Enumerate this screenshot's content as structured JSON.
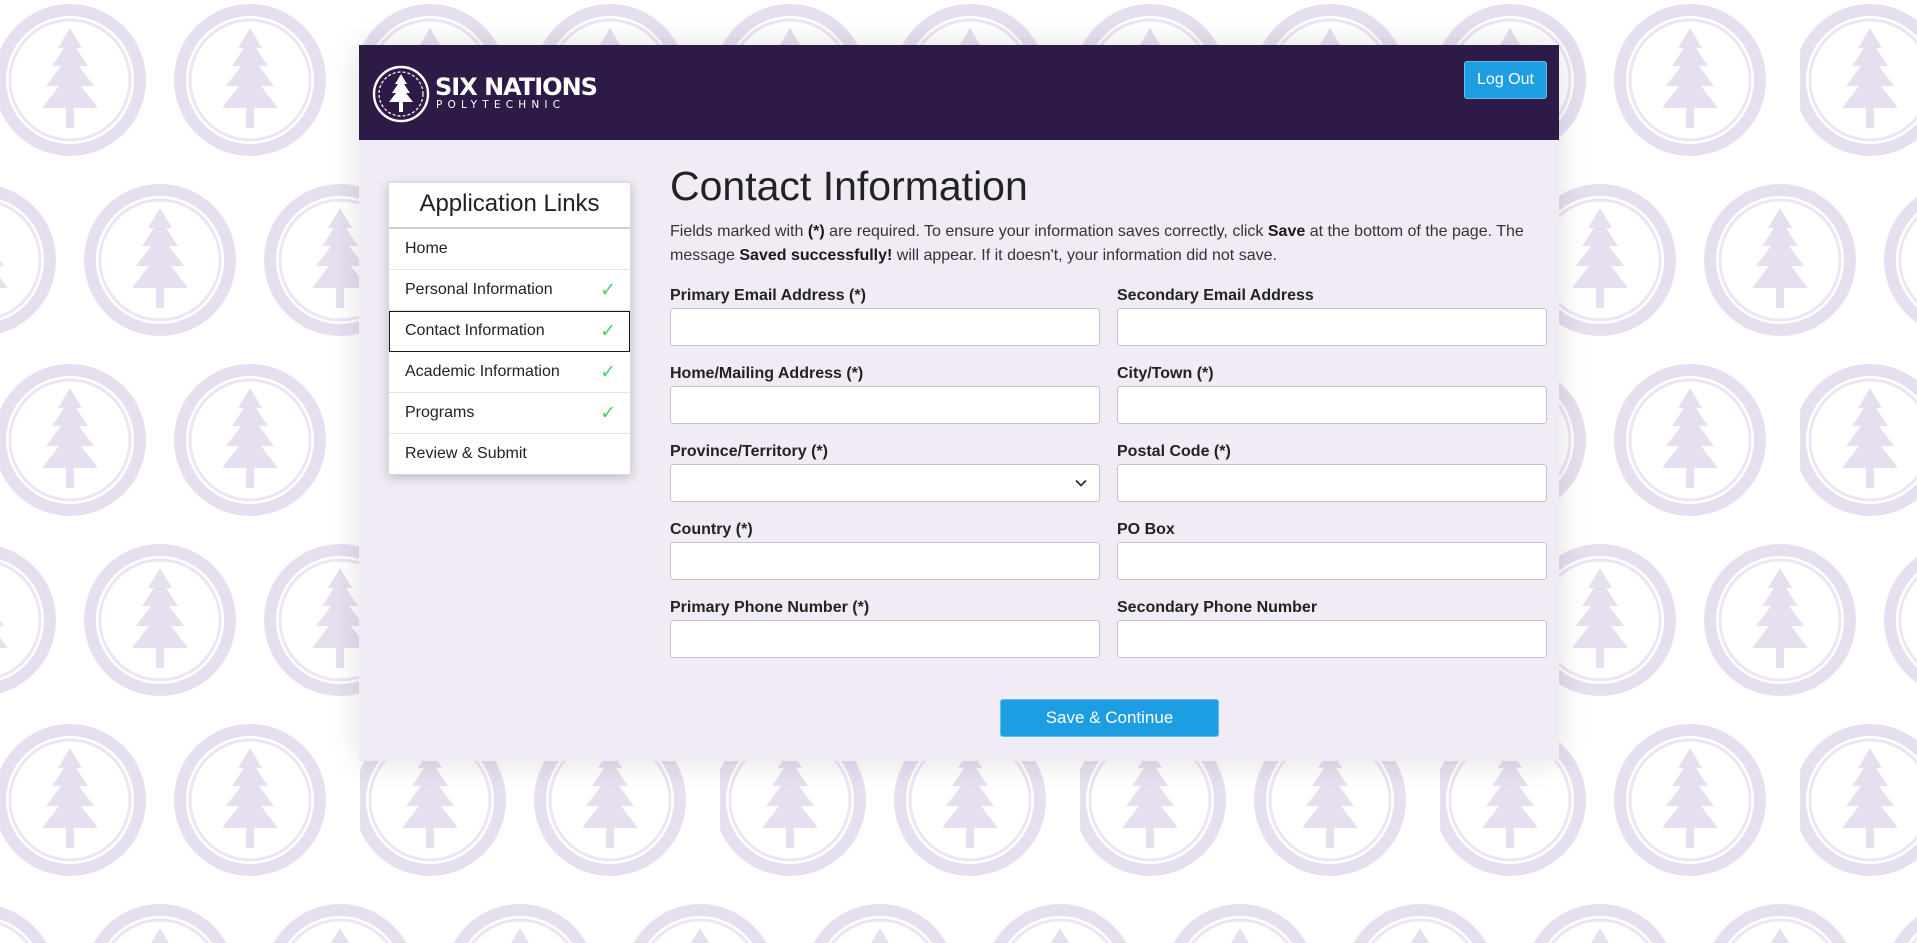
{
  "brand": {
    "name": "SIX NATIONS",
    "sub": "POLYTECHNIC",
    "logo_icon": "tree-emblem-icon",
    "bar_color": "#2e1a47",
    "accent": "#1d9ee3"
  },
  "header": {
    "logout_label": "Log Out"
  },
  "sidebar": {
    "title": "Application Links",
    "items": [
      {
        "label": "Home",
        "check": ""
      },
      {
        "label": "Personal Information",
        "check": "✓"
      },
      {
        "label": "Contact Information",
        "check": "✓"
      },
      {
        "label": "Academic Information",
        "check": "✓"
      },
      {
        "label": "Programs",
        "check": "✓"
      },
      {
        "label": "Review & Submit",
        "check": ""
      }
    ]
  },
  "main": {
    "title": "Contact Information",
    "intro": {
      "p1": "Fields marked with ",
      "b1": "(*)",
      "p2": " are required. To ensure your information saves correctly, click ",
      "b2": "Save",
      "p3": " at the bottom of the page. The message ",
      "b3": "Saved successfully!",
      "p4": " will appear. If it doesn't, your information did not save."
    },
    "fields": {
      "primary_email": {
        "label": "Primary Email Address (*)",
        "value": ""
      },
      "secondary_email": {
        "label": "Secondary Email Address",
        "value": ""
      },
      "home_address": {
        "label": "Home/Mailing Address (*)",
        "value": ""
      },
      "city": {
        "label": "City/Town (*)",
        "value": ""
      },
      "province": {
        "label": "Province/Territory (*)",
        "value": ""
      },
      "postal_code": {
        "label": "Postal Code (*)",
        "value": ""
      },
      "country": {
        "label": "Country (*)",
        "value": ""
      },
      "po_box": {
        "label": "PO Box",
        "value": ""
      },
      "primary_phone": {
        "label": "Primary Phone Number (*)",
        "value": ""
      },
      "secondary_phone": {
        "label": "Secondary Phone Number",
        "value": ""
      }
    },
    "save_label": "Save & Continue"
  }
}
